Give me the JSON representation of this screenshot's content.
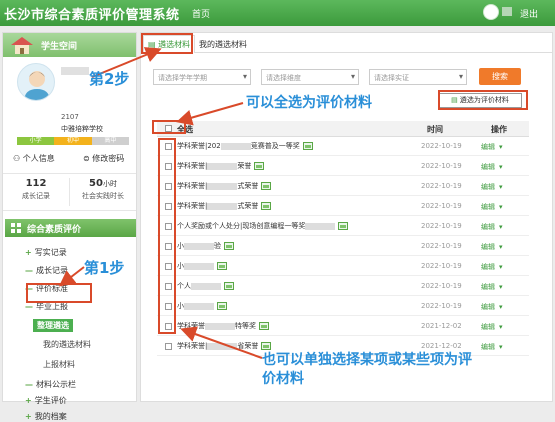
{
  "topbar": {
    "title": "长沙市综合素质评价管理系统",
    "home": "首页",
    "logout": "退出"
  },
  "profile": {
    "space_label": "学生空间",
    "user_id": "2107",
    "school": "中雅培粹学校",
    "grades": [
      {
        "label": "小学",
        "color": "#8cc63f"
      },
      {
        "label": "初中",
        "color": "#f3b21c"
      },
      {
        "label": "高中",
        "color": "#cfcfcf"
      }
    ],
    "info_link": "个人信息",
    "pwd_link": "修改密码",
    "stats": [
      {
        "value": "112",
        "unit": "",
        "caption": "成长记录"
      },
      {
        "value": "50",
        "unit": "小时",
        "caption": "社会实践时长"
      }
    ]
  },
  "nav": {
    "head": "综合素质评价",
    "items": [
      {
        "sym": "+",
        "label": "写实记录"
      },
      {
        "sym": "—",
        "label": "成长记录"
      },
      {
        "sym": "—",
        "label": "评价标准"
      },
      {
        "sym": "—",
        "label": "毕业上报"
      }
    ],
    "subs": [
      "整理遴选",
      "我的遴选材料",
      "上报材料"
    ],
    "more": [
      {
        "sym": "—",
        "label": "材料公示栏"
      },
      {
        "sym": "+",
        "label": "学生评价"
      },
      {
        "sym": "+",
        "label": "我的档案"
      }
    ]
  },
  "tabs": {
    "active": "遴选材料",
    "other": "我的遴选材料"
  },
  "filters": {
    "term": "请选择学年学期",
    "dimension": "请选择维度",
    "item": "请选择实证",
    "search": "搜索"
  },
  "select_eval_button": "遴选为评价材料",
  "table": {
    "select_all": "全选",
    "col_time": "时间",
    "col_op": "操作",
    "op_label": "编辑",
    "rows": [
      {
        "pre": "学科荣誉|202",
        "post": "竞赛普及一等奖",
        "time": "2022-10-19"
      },
      {
        "pre": "学科荣誉|",
        "post": "荣誉",
        "time": "2022-10-19"
      },
      {
        "pre": "学科荣誉|",
        "post": "式荣誉",
        "time": "2022-10-19"
      },
      {
        "pre": "学科荣誉|",
        "post": "式荣誉",
        "time": "2022-10-19"
      },
      {
        "pre": "个人奖励或个人处分|现场创意编程一等奖",
        "post": "",
        "time": "2022-10-19"
      },
      {
        "pre": "小",
        "post": "验",
        "time": "2022-10-19"
      },
      {
        "pre": "小",
        "post": "",
        "time": "2022-10-19"
      },
      {
        "pre": "个人",
        "post": "",
        "time": "2022-10-19"
      },
      {
        "pre": "小",
        "post": "",
        "time": "2022-10-19"
      },
      {
        "pre": "学科荣誉",
        "post": "特等奖",
        "time": "2021-12-02"
      },
      {
        "pre": "学科荣誉|",
        "post": "省荣誉",
        "time": "2021-12-02"
      }
    ]
  },
  "annotations": {
    "step1": "第1步",
    "step2": "第2步",
    "select_all_note": "可以全选为评价材料",
    "single_note_line1": "也可以单独选择某项或某些项为评",
    "single_note_line2": "价材料"
  },
  "colors": {
    "brand": "#3c9a3c",
    "accent": "#f07a2a",
    "annotation_text": "#2a8fd8",
    "annotation_arrow": "#d94a2a"
  }
}
